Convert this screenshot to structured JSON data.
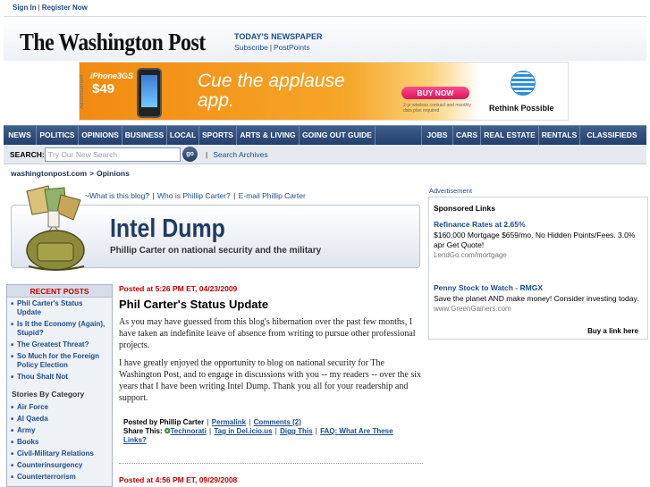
{
  "top_links": {
    "sign_in": "Sign In",
    "register": "Register Now"
  },
  "masthead": {
    "logo": "The Washington Post",
    "todays_newspaper": "TODAY'S NEWSPAPER",
    "subscribe": "Subscribe",
    "postpoints": "PostPoints"
  },
  "ad": {
    "vertical_label": "Advertisement",
    "model": "iPhone3GS",
    "price": "$49",
    "headline": "Cue the applause app.",
    "buy": "BUY NOW",
    "fine_print": "2-yr wireless contract and monthly data plan required",
    "tagline": "Rethink Possible",
    "colors": {
      "orange": "#f28a10",
      "pink": "#d9155d"
    }
  },
  "nav": {
    "items": [
      "NEWS",
      "POLITICS",
      "OPINIONS",
      "BUSINESS",
      "LOCAL",
      "SPORTS",
      "ARTS & LIVING",
      "GOING OUT GUIDE",
      "JOBS",
      "CARS",
      "REAL ESTATE",
      "RENTALS",
      "CLASSIFIEDS"
    ]
  },
  "search": {
    "label": "SEARCH:",
    "placeholder": "Try Our New Search",
    "go": "go",
    "archives": "Search Archives"
  },
  "breadcrumb": {
    "site": "washingtonpost.com",
    "arrow": ">",
    "section": "Opinions"
  },
  "blog": {
    "links": [
      "What is this blog?",
      "Who is Phillip Carter?",
      "E-mail Phillip Carter"
    ],
    "link_prefix": "~",
    "title": "Intel Dump",
    "subtitle": "Phillip Carter on national security and the military"
  },
  "sidebar": {
    "recent_header": "RECENT POSTS",
    "recent": [
      "Phil Carter's Status Update",
      "Is It the Economy (Again), Stupid?",
      "The Greatest Threat?",
      "So Much for the Foreign Policy Election",
      "Thou Shalt Not"
    ],
    "stories_header": "Stories By Category",
    "categories": [
      "Air Force",
      "Al Qaeda",
      "Army",
      "Books",
      "Civil-Military Relations",
      "Counterinsurgency",
      "Counterterrorism"
    ]
  },
  "post": {
    "meta": "Posted at 5:26 PM ET, 04/23/2009",
    "title": "Phil Carter's Status Update",
    "paragraphs": [
      "As you may have guessed from this blog's hibernation over the past few months, I have taken an indefinite leave of absence from writing to pursue other professional projects.",
      "I have greatly enjoyed the opportunity to blog on national security for The Washington Post, and to engage in discussions with you -- my readers -- over the six years that I have been writing Intel Dump. Thank you all for your readership and support."
    ],
    "posted_by": "Posted by Phillip Carter",
    "permalink": "Permalink",
    "comments": "Comments (2)",
    "share_label": "Share This:",
    "technorati": "Technorati",
    "delicious": "Tag in Del.icio.us",
    "digg": "Digg This",
    "faq": "FAQ: What Are These Links?"
  },
  "post2": {
    "meta": "Posted at 4:56 PM ET, 09/29/2008"
  },
  "right": {
    "advertisement": "Advertisement",
    "sponsored_header": "Sponsored Links",
    "links": [
      {
        "title": "Refinance Rates at 2.65%",
        "desc": "$160,000 Mortgage $659/mo. No Hidden Points/Fees. 3.0% apr Get Quote!",
        "url": "LendGo.com/mortgage"
      },
      {
        "title": "Penny Stock to Watch - RMGX",
        "desc": "Save the planet AND make money! Consider investing today.",
        "url": "www.GreenGainers.com"
      }
    ],
    "buy_link": "Buy a link here"
  }
}
